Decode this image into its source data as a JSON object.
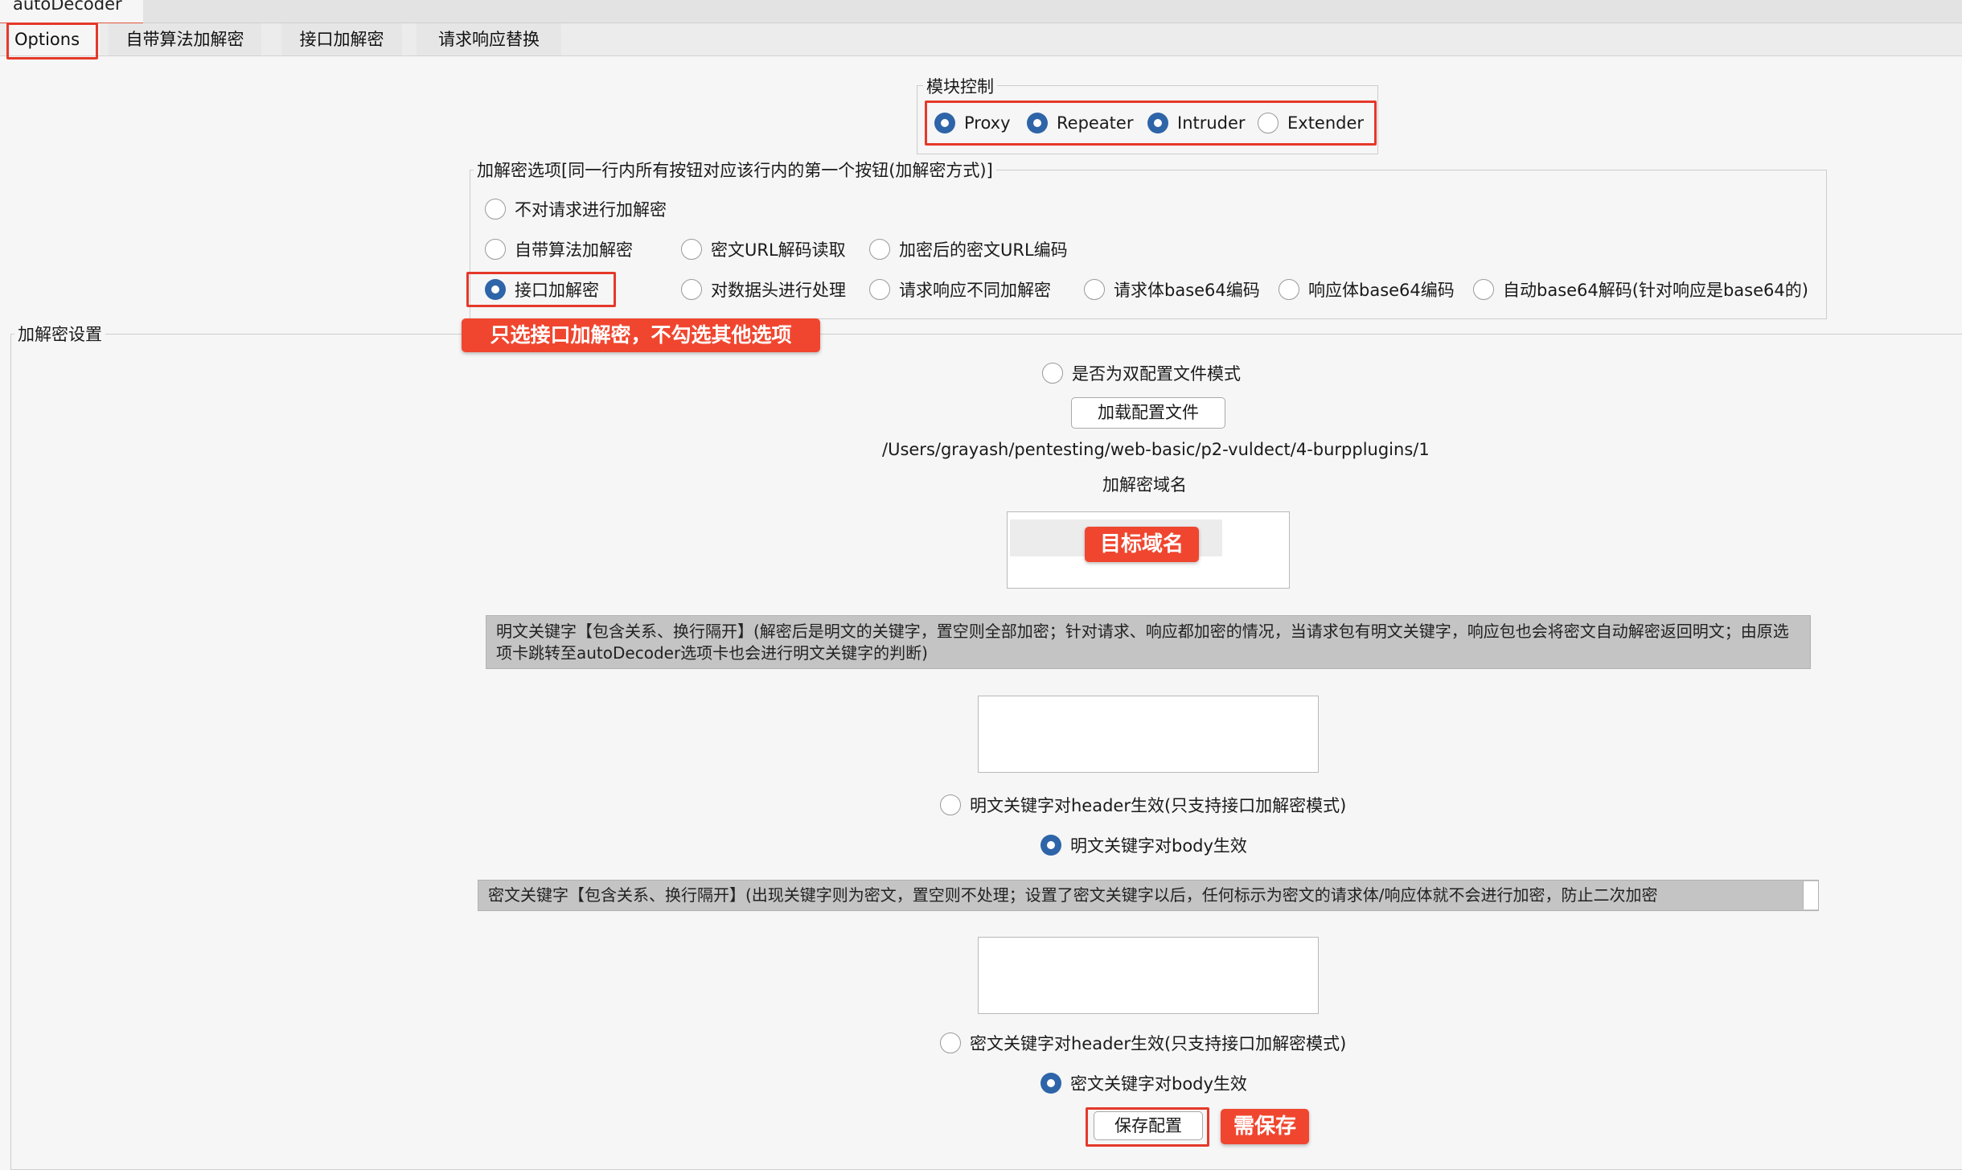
{
  "app": {
    "tab_label": "autoDecoder"
  },
  "tabs": [
    {
      "label": "Options"
    },
    {
      "label": "自带算法加解密"
    },
    {
      "label": "接口加解密"
    },
    {
      "label": "请求响应替换"
    }
  ],
  "module_control": {
    "title": "模块控制",
    "options": [
      {
        "label": "Proxy",
        "selected": true
      },
      {
        "label": "Repeater",
        "selected": true
      },
      {
        "label": "Intruder",
        "selected": true
      },
      {
        "label": "Extender",
        "selected": false
      }
    ]
  },
  "crypto_options": {
    "title": "加解密选项[同一行内所有按钮对应该行内的第一个按钮(加解密方式)]",
    "row1": [
      {
        "label": "不对请求进行加解密",
        "selected": false
      }
    ],
    "row2": [
      {
        "label": "自带算法加解密",
        "selected": false
      },
      {
        "label": "密文URL解码读取",
        "selected": false
      },
      {
        "label": "加密后的密文URL编码",
        "selected": false
      }
    ],
    "row3": [
      {
        "label": "接口加解密",
        "selected": true
      },
      {
        "label": "对数据头进行处理",
        "selected": false
      },
      {
        "label": "请求响应不同加解密",
        "selected": false
      },
      {
        "label": "请求体base64编码",
        "selected": false
      },
      {
        "label": "响应体base64编码",
        "selected": false
      },
      {
        "label": "自动base64解码(针对响应是base64的)",
        "selected": false
      }
    ]
  },
  "settings": {
    "title": "加解密设置",
    "dual_config": {
      "label": "是否为双配置文件模式",
      "selected": false
    },
    "load_config_button": "加载配置文件",
    "config_path": "/Users/grayash/pentesting/web-basic/p2-vuldect/4-burpplugins/1",
    "domain_label": "加解密域名",
    "plaintext_keyword_desc": "明文关键字【包含关系、换行隔开】(解密后是明文的关键字，置空则全部加密；针对请求、响应都加密的情况，当请求包有明文关键字，响应包也会将密文自动解密返回明文；由原选项卡跳转至autoDecoder选项卡也会进行明文关键字的判断)",
    "plaintext_header": {
      "label": "明文关键字对header生效(只支持接口加解密模式)",
      "selected": false
    },
    "plaintext_body": {
      "label": "明文关键字对body生效",
      "selected": true
    },
    "ciphertext_keyword_desc": "密文关键字【包含关系、换行隔开】(出现关键字则为密文，置空则不处理；设置了密文关键字以后，任何标示为密文的请求体/响应体就不会进行加密，防止二次加密",
    "ciphertext_header": {
      "label": "密文关键字对header生效(只支持接口加解密模式)",
      "selected": false
    },
    "ciphertext_body": {
      "label": "密文关键字对body生效",
      "selected": true
    },
    "save_button": "保存配置"
  },
  "annotations": {
    "only_api": "只选接口加解密，不勾选其他选项",
    "target_domain": "目标域名",
    "need_save": "需保存"
  },
  "colors": {
    "accent_red": "#e5392a",
    "annotation_bg": "#f0462f",
    "radio_selected": "#2e64a8",
    "background": "#f6f6f6"
  }
}
